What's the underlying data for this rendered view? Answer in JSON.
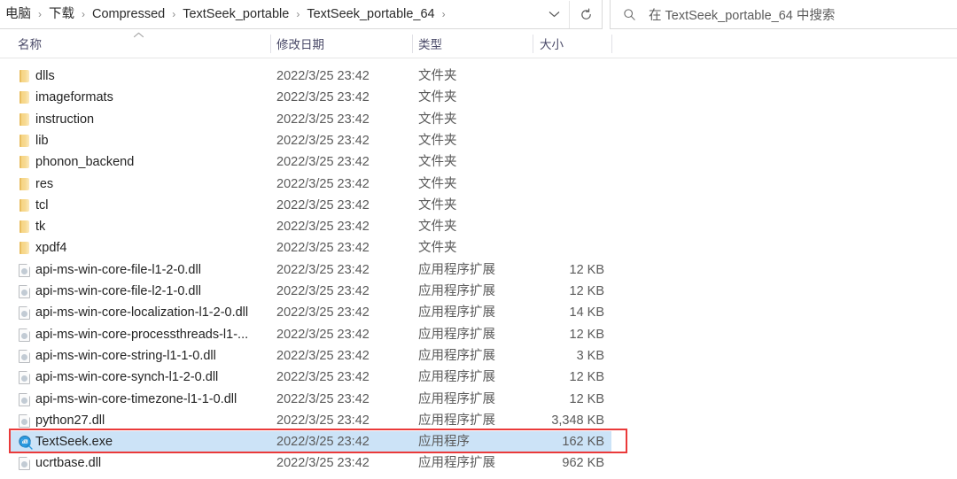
{
  "toolbar": {
    "breadcrumb": {
      "name": "address-breadcrumb",
      "separator": "›",
      "items": [
        {
          "label": "电脑"
        },
        {
          "label": "下载"
        },
        {
          "label": "Compressed"
        },
        {
          "label": "TextSeek_portable"
        },
        {
          "label": "TextSeek_portable_64"
        }
      ]
    },
    "history_dropdown_icon": "chevron-down-icon",
    "refresh_icon": "refresh-icon",
    "search": {
      "icon": "search-icon",
      "placeholder": "在 TextSeek_portable_64 中搜索"
    }
  },
  "columns": {
    "name": "名称",
    "date_modified": "修改日期",
    "type": "类型",
    "size": "大小",
    "sort_caret": "⌃"
  },
  "files": [
    {
      "name": "dlls",
      "date": "2022/3/25 23:42",
      "type": "文件夹",
      "size": "",
      "icon": "folder-icon",
      "selected": false
    },
    {
      "name": "imageformats",
      "date": "2022/3/25 23:42",
      "type": "文件夹",
      "size": "",
      "icon": "folder-icon",
      "selected": false
    },
    {
      "name": "instruction",
      "date": "2022/3/25 23:42",
      "type": "文件夹",
      "size": "",
      "icon": "folder-icon",
      "selected": false
    },
    {
      "name": "lib",
      "date": "2022/3/25 23:42",
      "type": "文件夹",
      "size": "",
      "icon": "folder-icon",
      "selected": false
    },
    {
      "name": "phonon_backend",
      "date": "2022/3/25 23:42",
      "type": "文件夹",
      "size": "",
      "icon": "folder-icon",
      "selected": false
    },
    {
      "name": "res",
      "date": "2022/3/25 23:42",
      "type": "文件夹",
      "size": "",
      "icon": "folder-icon",
      "selected": false
    },
    {
      "name": "tcl",
      "date": "2022/3/25 23:42",
      "type": "文件夹",
      "size": "",
      "icon": "folder-icon",
      "selected": false
    },
    {
      "name": "tk",
      "date": "2022/3/25 23:42",
      "type": "文件夹",
      "size": "",
      "icon": "folder-icon",
      "selected": false
    },
    {
      "name": "xpdf4",
      "date": "2022/3/25 23:42",
      "type": "文件夹",
      "size": "",
      "icon": "folder-icon",
      "selected": false
    },
    {
      "name": "api-ms-win-core-file-l1-2-0.dll",
      "date": "2022/3/25 23:42",
      "type": "应用程序扩展",
      "size": "12 KB",
      "icon": "dll-file-icon",
      "selected": false
    },
    {
      "name": "api-ms-win-core-file-l2-1-0.dll",
      "date": "2022/3/25 23:42",
      "type": "应用程序扩展",
      "size": "12 KB",
      "icon": "dll-file-icon",
      "selected": false
    },
    {
      "name": "api-ms-win-core-localization-l1-2-0.dll",
      "date": "2022/3/25 23:42",
      "type": "应用程序扩展",
      "size": "14 KB",
      "icon": "dll-file-icon",
      "selected": false
    },
    {
      "name": "api-ms-win-core-processthreads-l1-...",
      "date": "2022/3/25 23:42",
      "type": "应用程序扩展",
      "size": "12 KB",
      "icon": "dll-file-icon",
      "selected": false
    },
    {
      "name": "api-ms-win-core-string-l1-1-0.dll",
      "date": "2022/3/25 23:42",
      "type": "应用程序扩展",
      "size": "3 KB",
      "icon": "dll-file-icon",
      "selected": false
    },
    {
      "name": "api-ms-win-core-synch-l1-2-0.dll",
      "date": "2022/3/25 23:42",
      "type": "应用程序扩展",
      "size": "12 KB",
      "icon": "dll-file-icon",
      "selected": false
    },
    {
      "name": "api-ms-win-core-timezone-l1-1-0.dll",
      "date": "2022/3/25 23:42",
      "type": "应用程序扩展",
      "size": "12 KB",
      "icon": "dll-file-icon",
      "selected": false
    },
    {
      "name": "python27.dll",
      "date": "2022/3/25 23:42",
      "type": "应用程序扩展",
      "size": "3,348 KB",
      "icon": "dll-file-icon",
      "selected": false
    },
    {
      "name": "TextSeek.exe",
      "date": "2022/3/25 23:42",
      "type": "应用程序",
      "size": "162 KB",
      "icon": "textseek-app-icon",
      "selected": true
    },
    {
      "name": "ucrtbase.dll",
      "date": "2022/3/25 23:42",
      "type": "应用程序扩展",
      "size": "962 KB",
      "icon": "dll-file-icon",
      "selected": false
    }
  ],
  "annotation": {
    "target": "TextSeek.exe",
    "color": "#ea3a3a"
  },
  "colors": {
    "selection": "#cce3f7",
    "folder": "#f6d27e",
    "accent": "#2b9ae0"
  }
}
